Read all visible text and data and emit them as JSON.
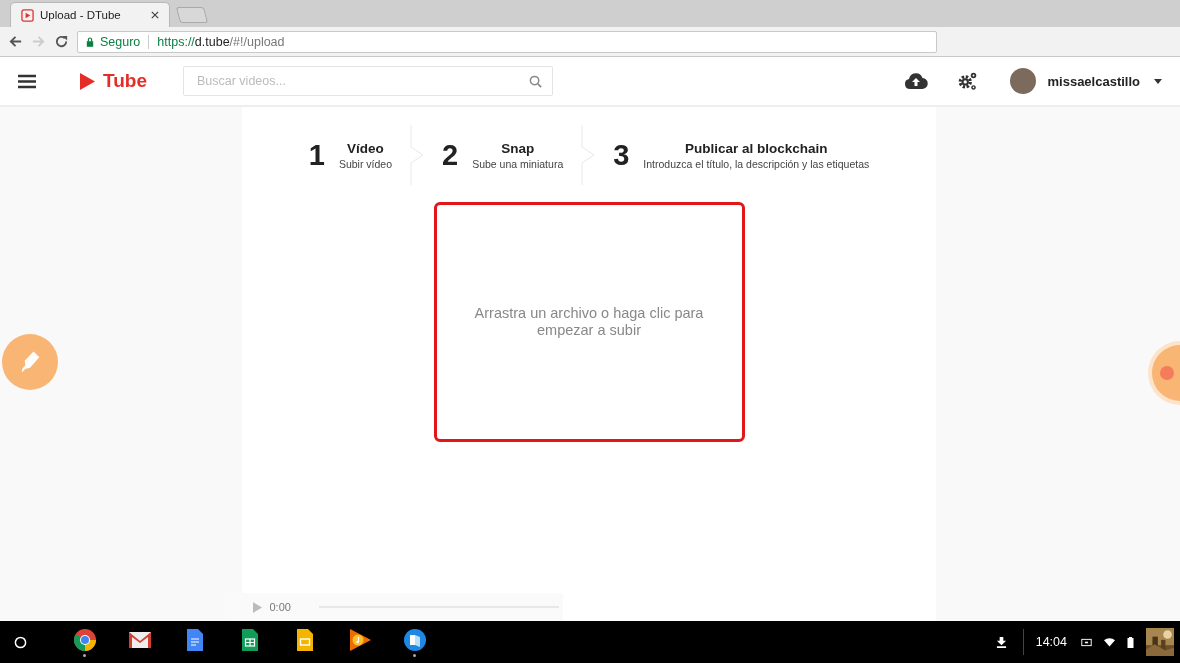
{
  "browser": {
    "tab": {
      "title": "Upload - DTube"
    },
    "address": {
      "secure_label": "Seguro",
      "url_scheme": "https://",
      "url_host": "d.tube",
      "url_path": "/#!/upload"
    }
  },
  "header": {
    "logo": "Tube",
    "search": {
      "placeholder": "Buscar videos..."
    },
    "username": "missaelcastillo"
  },
  "steps": [
    {
      "number": "1",
      "title": "Vídeo",
      "subtitle": "Subir vídeo"
    },
    {
      "number": "2",
      "title": "Snap",
      "subtitle": "Sube una miniatura"
    },
    {
      "number": "3",
      "title": "Publicar al blockchain",
      "subtitle": "Introduzca el título, la descripción y las etiquetas"
    }
  ],
  "dropzone": {
    "text": "Arrastra un archivo o haga clic para empezar a subir"
  },
  "player": {
    "time": "0:00"
  },
  "taskbar": {
    "apps": [
      {
        "kind": "chrome",
        "running": true
      },
      {
        "kind": "gmail",
        "running": false
      },
      {
        "kind": "docs",
        "running": false
      },
      {
        "kind": "sheets",
        "running": false
      },
      {
        "kind": "slides",
        "running": false
      },
      {
        "kind": "music",
        "running": false
      },
      {
        "kind": "files",
        "running": true
      }
    ],
    "clock": "14:04"
  }
}
